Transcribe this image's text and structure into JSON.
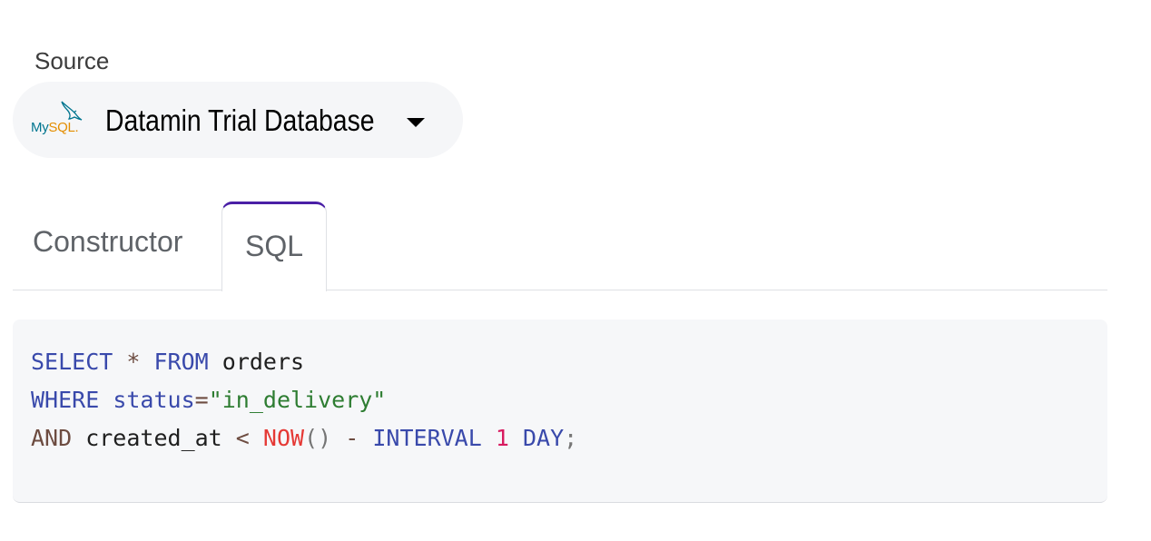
{
  "source": {
    "label": "Source",
    "selected_database": "Datamin Trial Database",
    "logo": {
      "my_text": "My",
      "sql_text": "SQL",
      "dot_text": ".",
      "icon": "mysql-dolphin-icon",
      "colors": {
        "my": "#00758f",
        "sql": "#e48e00"
      }
    },
    "dropdown_icon": "caret-down-icon"
  },
  "tabs": [
    {
      "label": "Constructor",
      "active": false
    },
    {
      "label": "SQL",
      "active": true
    }
  ],
  "accent_color": "#4a1fa6",
  "query": {
    "lines": [
      [
        {
          "t": "SELECT",
          "c": "kw"
        },
        {
          "t": " ",
          "c": "id"
        },
        {
          "t": "*",
          "c": "op"
        },
        {
          "t": " ",
          "c": "id"
        },
        {
          "t": "FROM",
          "c": "kw"
        },
        {
          "t": " orders",
          "c": "id"
        }
      ],
      [
        {
          "t": "WHERE",
          "c": "kw"
        },
        {
          "t": " status",
          "c": "kw"
        },
        {
          "t": "=",
          "c": "op"
        },
        {
          "t": "\"in_delivery\"",
          "c": "str"
        }
      ],
      [
        {
          "t": "AND",
          "c": "kw2"
        },
        {
          "t": " created_at ",
          "c": "id"
        },
        {
          "t": "<",
          "c": "op"
        },
        {
          "t": " ",
          "c": "id"
        },
        {
          "t": "NOW",
          "c": "fn"
        },
        {
          "t": "()",
          "c": "punc"
        },
        {
          "t": " ",
          "c": "id"
        },
        {
          "t": "-",
          "c": "op"
        },
        {
          "t": " ",
          "c": "id"
        },
        {
          "t": "INTERVAL",
          "c": "kw"
        },
        {
          "t": " ",
          "c": "id"
        },
        {
          "t": "1",
          "c": "num"
        },
        {
          "t": " ",
          "c": "id"
        },
        {
          "t": "DAY",
          "c": "kw"
        },
        {
          "t": ";",
          "c": "punc"
        }
      ]
    ]
  }
}
